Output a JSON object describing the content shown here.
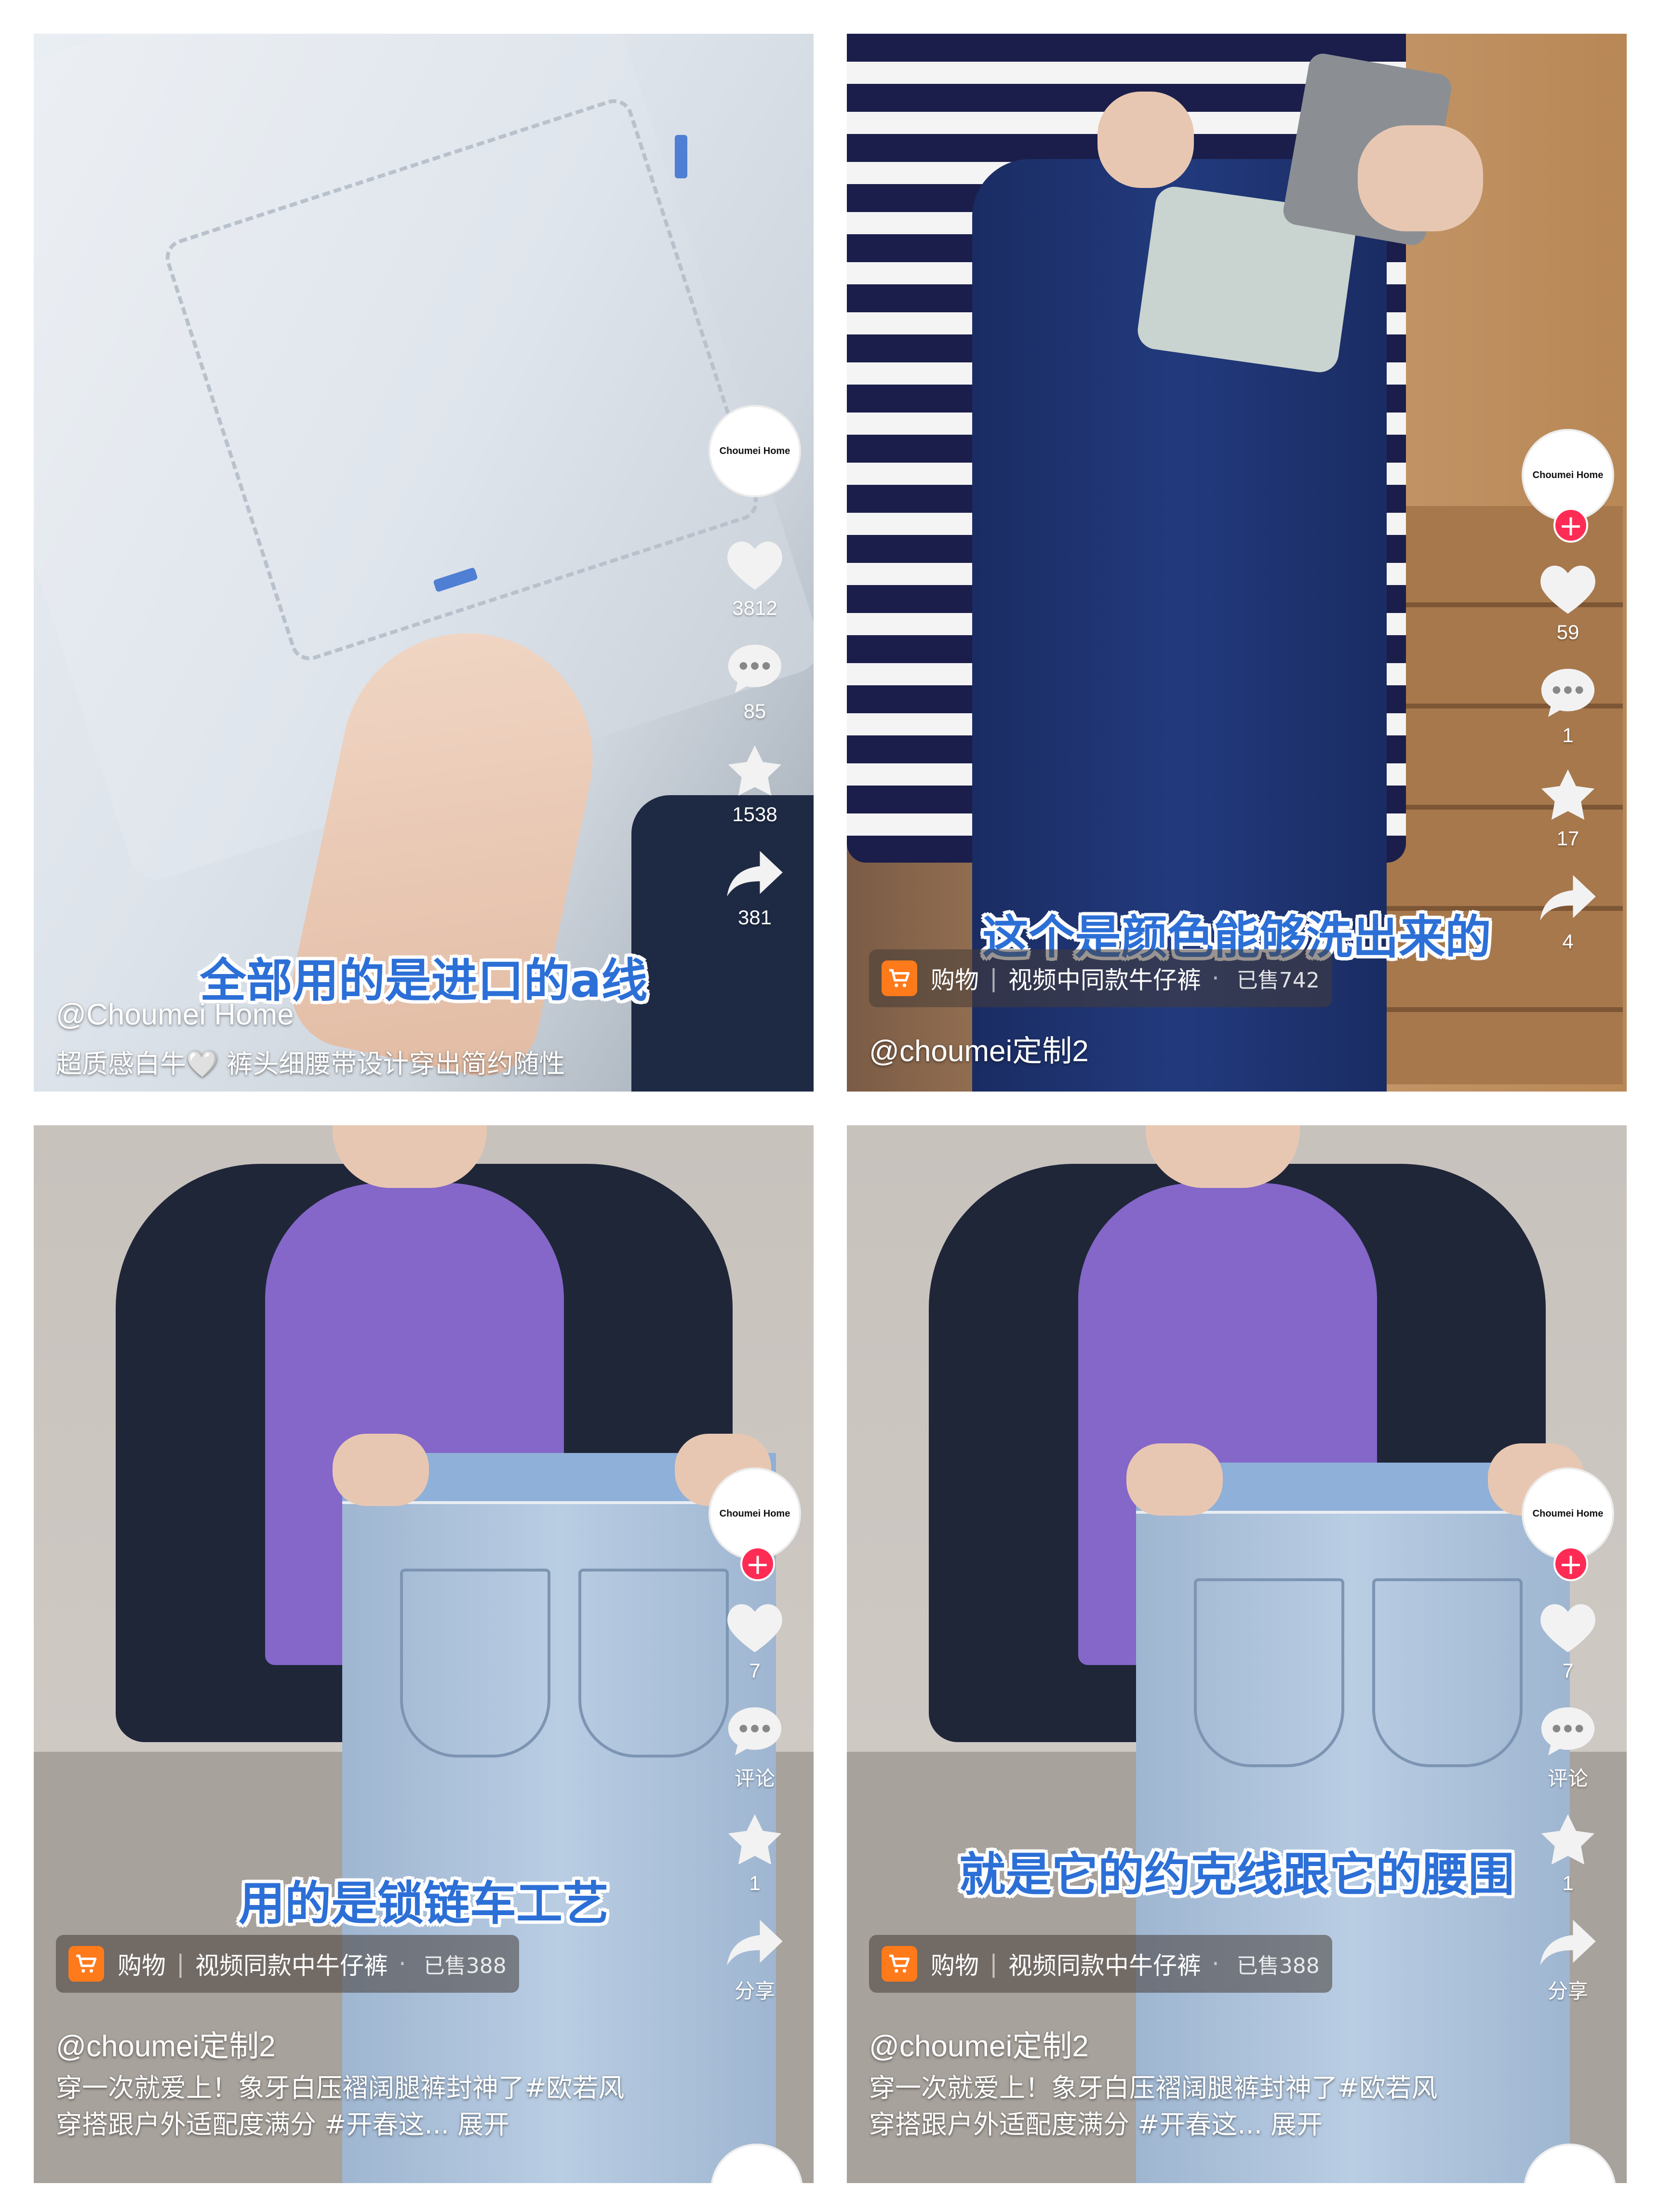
{
  "panels": [
    {
      "avatar_text": "Choumei Home",
      "likes": "3812",
      "comments": "85",
      "favorites": "1538",
      "shares": "381",
      "caption": "全部用的是进口的a线",
      "handle": "@Choumei Home",
      "description": "超质感白牛🤍 裤头细腰带设计穿出简约随性"
    },
    {
      "avatar_text": "Choumei Home",
      "likes": "59",
      "comments": "1",
      "favorites": "17",
      "shares": "4",
      "caption": "这个是颜色能够洗出来的",
      "shop_label": "购物",
      "shop_product": "视频中同款牛仔裤",
      "shop_sold": "已售742",
      "handle": "@choumei定制2"
    },
    {
      "avatar_text": "Choumei Home",
      "likes": "7",
      "comments": "评论",
      "favorites": "1",
      "shares": "分享",
      "caption": "用的是锁链车工艺",
      "shop_label": "购物",
      "shop_product": "视频同款中牛仔裤",
      "shop_sold": "已售388",
      "handle": "@choumei定制2",
      "description": "穿一次就爱上！象牙白压褶阔腿裤封神了#欧若风穿搭跟户外适配度满分 #开春这... 展开"
    },
    {
      "avatar_text": "Choumei Home",
      "likes": "7",
      "comments": "评论",
      "favorites": "1",
      "shares": "分享",
      "caption": "就是它的约克线跟它的腰围",
      "shop_label": "购物",
      "shop_product": "视频同款中牛仔裤",
      "shop_sold": "已售388",
      "handle": "@choumei定制2",
      "description": "穿一次就爱上！象牙白压褶阔腿裤封神了#欧若风穿搭跟户外适配度满分 #开春这... 展开"
    }
  ],
  "icons": [
    "heart-icon",
    "comment-icon",
    "star-icon",
    "share-icon",
    "cart-icon",
    "follow-plus-icon"
  ],
  "colors": {
    "caption_blue": "#2c6fd6",
    "follow_red": "#fe2c55",
    "cart_orange": "#ff7a1a"
  }
}
